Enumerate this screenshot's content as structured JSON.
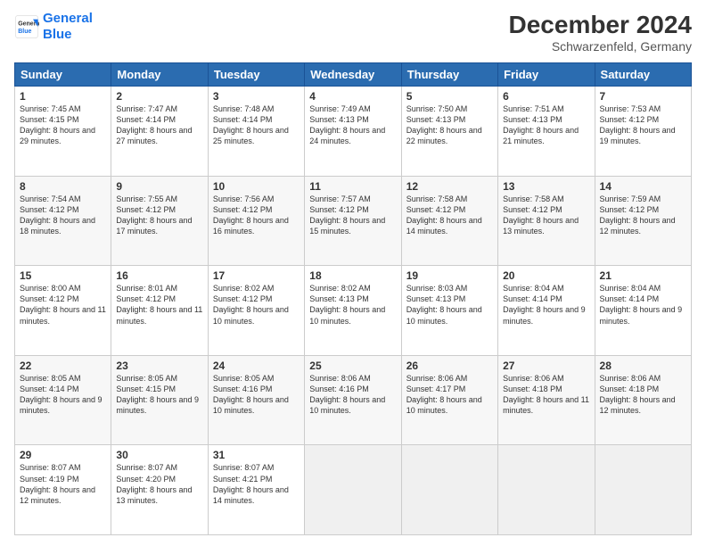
{
  "header": {
    "logo_line1": "General",
    "logo_line2": "Blue",
    "month_year": "December 2024",
    "location": "Schwarzenfeld, Germany"
  },
  "days_of_week": [
    "Sunday",
    "Monday",
    "Tuesday",
    "Wednesday",
    "Thursday",
    "Friday",
    "Saturday"
  ],
  "weeks": [
    [
      {
        "day": "1",
        "sunrise": "7:45 AM",
        "sunset": "4:15 PM",
        "daylight": "8 hours and 29 minutes."
      },
      {
        "day": "2",
        "sunrise": "7:47 AM",
        "sunset": "4:14 PM",
        "daylight": "8 hours and 27 minutes."
      },
      {
        "day": "3",
        "sunrise": "7:48 AM",
        "sunset": "4:14 PM",
        "daylight": "8 hours and 25 minutes."
      },
      {
        "day": "4",
        "sunrise": "7:49 AM",
        "sunset": "4:13 PM",
        "daylight": "8 hours and 24 minutes."
      },
      {
        "day": "5",
        "sunrise": "7:50 AM",
        "sunset": "4:13 PM",
        "daylight": "8 hours and 22 minutes."
      },
      {
        "day": "6",
        "sunrise": "7:51 AM",
        "sunset": "4:13 PM",
        "daylight": "8 hours and 21 minutes."
      },
      {
        "day": "7",
        "sunrise": "7:53 AM",
        "sunset": "4:12 PM",
        "daylight": "8 hours and 19 minutes."
      }
    ],
    [
      {
        "day": "8",
        "sunrise": "7:54 AM",
        "sunset": "4:12 PM",
        "daylight": "8 hours and 18 minutes."
      },
      {
        "day": "9",
        "sunrise": "7:55 AM",
        "sunset": "4:12 PM",
        "daylight": "8 hours and 17 minutes."
      },
      {
        "day": "10",
        "sunrise": "7:56 AM",
        "sunset": "4:12 PM",
        "daylight": "8 hours and 16 minutes."
      },
      {
        "day": "11",
        "sunrise": "7:57 AM",
        "sunset": "4:12 PM",
        "daylight": "8 hours and 15 minutes."
      },
      {
        "day": "12",
        "sunrise": "7:58 AM",
        "sunset": "4:12 PM",
        "daylight": "8 hours and 14 minutes."
      },
      {
        "day": "13",
        "sunrise": "7:58 AM",
        "sunset": "4:12 PM",
        "daylight": "8 hours and 13 minutes."
      },
      {
        "day": "14",
        "sunrise": "7:59 AM",
        "sunset": "4:12 PM",
        "daylight": "8 hours and 12 minutes."
      }
    ],
    [
      {
        "day": "15",
        "sunrise": "8:00 AM",
        "sunset": "4:12 PM",
        "daylight": "8 hours and 11 minutes."
      },
      {
        "day": "16",
        "sunrise": "8:01 AM",
        "sunset": "4:12 PM",
        "daylight": "8 hours and 11 minutes."
      },
      {
        "day": "17",
        "sunrise": "8:02 AM",
        "sunset": "4:12 PM",
        "daylight": "8 hours and 10 minutes."
      },
      {
        "day": "18",
        "sunrise": "8:02 AM",
        "sunset": "4:13 PM",
        "daylight": "8 hours and 10 minutes."
      },
      {
        "day": "19",
        "sunrise": "8:03 AM",
        "sunset": "4:13 PM",
        "daylight": "8 hours and 10 minutes."
      },
      {
        "day": "20",
        "sunrise": "8:04 AM",
        "sunset": "4:14 PM",
        "daylight": "8 hours and 9 minutes."
      },
      {
        "day": "21",
        "sunrise": "8:04 AM",
        "sunset": "4:14 PM",
        "daylight": "8 hours and 9 minutes."
      }
    ],
    [
      {
        "day": "22",
        "sunrise": "8:05 AM",
        "sunset": "4:14 PM",
        "daylight": "8 hours and 9 minutes."
      },
      {
        "day": "23",
        "sunrise": "8:05 AM",
        "sunset": "4:15 PM",
        "daylight": "8 hours and 9 minutes."
      },
      {
        "day": "24",
        "sunrise": "8:05 AM",
        "sunset": "4:16 PM",
        "daylight": "8 hours and 10 minutes."
      },
      {
        "day": "25",
        "sunrise": "8:06 AM",
        "sunset": "4:16 PM",
        "daylight": "8 hours and 10 minutes."
      },
      {
        "day": "26",
        "sunrise": "8:06 AM",
        "sunset": "4:17 PM",
        "daylight": "8 hours and 10 minutes."
      },
      {
        "day": "27",
        "sunrise": "8:06 AM",
        "sunset": "4:18 PM",
        "daylight": "8 hours and 11 minutes."
      },
      {
        "day": "28",
        "sunrise": "8:06 AM",
        "sunset": "4:18 PM",
        "daylight": "8 hours and 12 minutes."
      }
    ],
    [
      {
        "day": "29",
        "sunrise": "8:07 AM",
        "sunset": "4:19 PM",
        "daylight": "8 hours and 12 minutes."
      },
      {
        "day": "30",
        "sunrise": "8:07 AM",
        "sunset": "4:20 PM",
        "daylight": "8 hours and 13 minutes."
      },
      {
        "day": "31",
        "sunrise": "8:07 AM",
        "sunset": "4:21 PM",
        "daylight": "8 hours and 14 minutes."
      },
      null,
      null,
      null,
      null
    ]
  ]
}
